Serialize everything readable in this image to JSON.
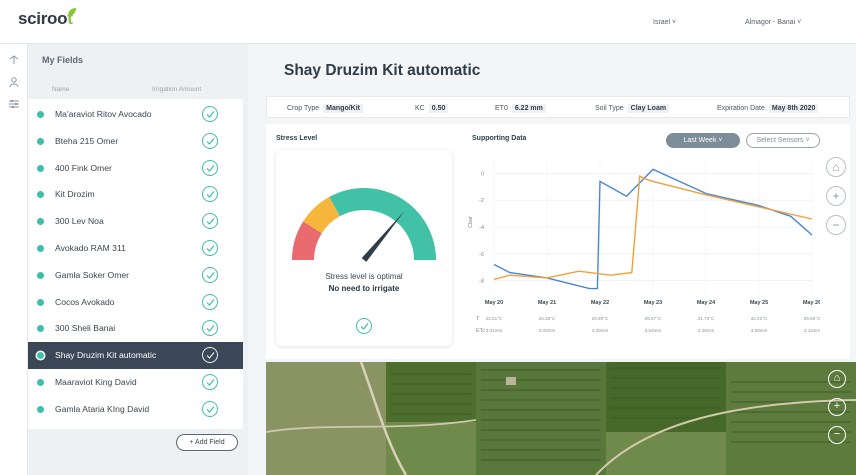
{
  "header": {
    "logo_main": "sciroo",
    "logo_accent": "t",
    "region": "Israel ˅",
    "farm": "Almagor - Banai ˅"
  },
  "sidebar": {
    "title": "My Fields",
    "col_name": "Name",
    "col_irrigation": "Irrigation Amount",
    "items": [
      {
        "label": "Ma'araviot Ritov Avocado"
      },
      {
        "label": "Bteha 215 Omer"
      },
      {
        "label": "400 Fink Omer"
      },
      {
        "label": "Kit Drozim"
      },
      {
        "label": "300 Lev Noa"
      },
      {
        "label": "Avokado RAM 311"
      },
      {
        "label": "Gamla Soker Omer"
      },
      {
        "label": "Cocos Avokado"
      },
      {
        "label": "300 Sheli Banai"
      },
      {
        "label": "Shay Druzim Kit automatic"
      },
      {
        "label": "Maaraviot King David"
      },
      {
        "label": "Gamla Ataria KIng David"
      }
    ],
    "add_button": "+ Add Field"
  },
  "main": {
    "title": "Shay Druzim Kit automatic",
    "info": {
      "crop_label": "Crop Type",
      "crop_value": "Mango/Kit",
      "kc_label": "KC",
      "kc_value": "0.50",
      "eto_label": "ET0",
      "eto_value": "6.22 mm",
      "soil_label": "Soil Type",
      "soil_value": "Clay Loam",
      "exp_label": "Expiration Date",
      "exp_value": "May 8th 2020"
    },
    "stress": {
      "title": "Stress Level",
      "message": "Stress level is optimal",
      "action": "No need to irrigate"
    },
    "supporting": {
      "title": "Supporting Data",
      "period_button": "Last Week ˅",
      "sensors_button": "Select Sensors ˅"
    }
  },
  "chart_data": {
    "type": "line",
    "ylabel": "Cbar",
    "categories": [
      "May 20",
      "May 21",
      "May 22",
      "May 23",
      "May 24",
      "May 25",
      "May 26"
    ],
    "y_ticks": [
      "0",
      "-2",
      "-4",
      "-6",
      "-8"
    ],
    "ylim": [
      -9,
      1
    ],
    "series": [
      {
        "color": "#4a86d8",
        "x": [
          0,
          0.3,
          1,
          1.8,
          1.95,
          2,
          2.5,
          3,
          4,
          5,
          5.6,
          6
        ],
        "values": [
          -6.8,
          -7.4,
          -7.8,
          -8.6,
          -8.6,
          -0.6,
          -1.7,
          0.3,
          -1.5,
          -2.4,
          -3.2,
          -4.6
        ]
      },
      {
        "color": "#f0a03c",
        "x": [
          0,
          0.3,
          1,
          1.6,
          2.2,
          2.6,
          2.75,
          2.85,
          3,
          4,
          5,
          6
        ],
        "values": [
          -7.9,
          -7.6,
          -7.8,
          -7.3,
          -7.6,
          -7.4,
          -0.2,
          -0.4,
          -0.6,
          -1.6,
          -2.5,
          -3.4
        ]
      }
    ],
    "rows": [
      {
        "label": "T",
        "values": [
          "22.51°C",
          "25.38°C",
          "26.60°C",
          "25.57°C",
          "31.76°C",
          "32.22°C",
          "26.65°C"
        ]
      },
      {
        "label": "ETc",
        "values": [
          "3.01mm",
          "3.03mm",
          "3.30mm",
          "3.54mm",
          "3.36mm",
          "3.60mm",
          "3.11mm"
        ]
      }
    ]
  },
  "gauge": {
    "level": 0.72,
    "segments": [
      "#e96a6f",
      "#f5b63b",
      "#41c1a6"
    ]
  },
  "icons": [
    "leaf-icon",
    "tree-icon",
    "user-icon",
    "sliders-icon",
    "check-circle-icon",
    "home-icon",
    "zoom-in-icon",
    "zoom-out-icon"
  ]
}
